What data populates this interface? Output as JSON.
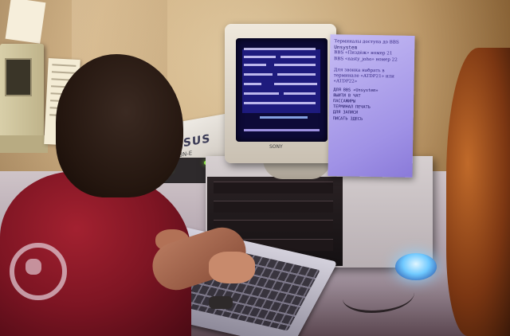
{
  "scene": {
    "description_colors": {
      "wall": "#d9bd8c",
      "shirt": "#8e1a28",
      "crt_screen": "#0d0a38",
      "note_paper": "#b3a6ef",
      "blue_light": "#6fc9ff",
      "led": "#9dff4a"
    }
  },
  "box": {
    "brand": "ASUS",
    "model": "K8N-E"
  },
  "monitor": {
    "brand": "SONY"
  },
  "note": {
    "lines": [
      "Терминалы доступа до BBS",
      "Unsystem",
      "BBS «Пиздёж» номер 21",
      "BBS «nasty_joho» номер 22",
      "",
      "Для звонка набрать в",
      "терминале «ATDP21» или",
      "«ATDP22»"
    ],
    "handwritten": [
      "ДЛЯ BBS «Unsystem»",
      "ВЫЙТИ В ЧАТ",
      "ПАССАЖИРЫ",
      "ТЕРМИНАЛ ПЕЧАТЬ",
      "ДЛЯ ЗАПИСИ",
      "ПИСАТЬ ЗДЕСЬ"
    ]
  }
}
